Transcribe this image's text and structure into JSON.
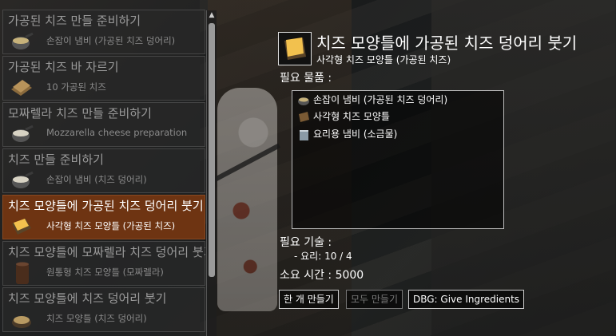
{
  "recipes": [
    {
      "title": "가공된 치즈 만들 준비하기",
      "subtitle": "손잡이 냄비 (가공된 치즈 덩어리)",
      "icon": "saucepan-icon",
      "selected": false
    },
    {
      "title": "가공된 치즈 바 자르기",
      "subtitle": "10 가공된 치즈",
      "icon": "cheese-slices-icon",
      "selected": false
    },
    {
      "title": "모짜렐라 치즈 만들 준비하기",
      "subtitle": "Mozzarella cheese preparation",
      "icon": "saucepan-icon",
      "selected": false
    },
    {
      "title": "치즈 만들 준비하기",
      "subtitle": "손잡이 냄비 (치즈 덩어리)",
      "icon": "saucepan-icon",
      "selected": false
    },
    {
      "title": "치즈 모양틀에 가공된 치즈 덩어리 붓기",
      "subtitle": "사각형 치즈 모양틀 (가공된 치즈)",
      "icon": "cheese-mold-icon",
      "selected": true
    },
    {
      "title": "치즈 모양틀에 모짜렐라 치즈 덩어리 붓기",
      "subtitle": "원통형 치즈 모양틀 (모짜렐라)",
      "icon": "cylinder-mold-icon",
      "selected": false
    },
    {
      "title": "치즈 모양틀에 치즈 덩어리 붓기",
      "subtitle": "치즈 모양틀 (치즈 덩어리)",
      "icon": "round-mold-icon",
      "selected": false
    }
  ],
  "scrollbar": {
    "up_arrow": "▲"
  },
  "detail": {
    "icon": "cheese-mold-icon",
    "title": "치즈 모양틀에 가공된 치즈 덩어리 붓기",
    "subtitle": "사각형 치즈 모양틀 (가공된 치즈)",
    "ingredients_label": "필요 물품 :",
    "ingredients": [
      {
        "icon": "saucepan-icon",
        "label": "손잡이 냄비 (가공된 치즈 덩어리)"
      },
      {
        "icon": "cheese-mold-icon",
        "label": "사각형 치즈 모양틀"
      },
      {
        "icon": "cooking-pot-icon",
        "label": "요리용 냄비 (소금물)"
      }
    ],
    "skills_label": "필요 기술 :",
    "skill_line": "- 요리: 10 / 4",
    "time_label": "소요 시간 : 5000"
  },
  "buttons": {
    "craft_one": "한 개 만들기",
    "craft_all": "모두 만들기",
    "debug": "DBG: Give Ingredients"
  },
  "colors": {
    "selected_bg": "#6e3412",
    "text": "#ffffff",
    "muted": "#9a9a9a"
  }
}
